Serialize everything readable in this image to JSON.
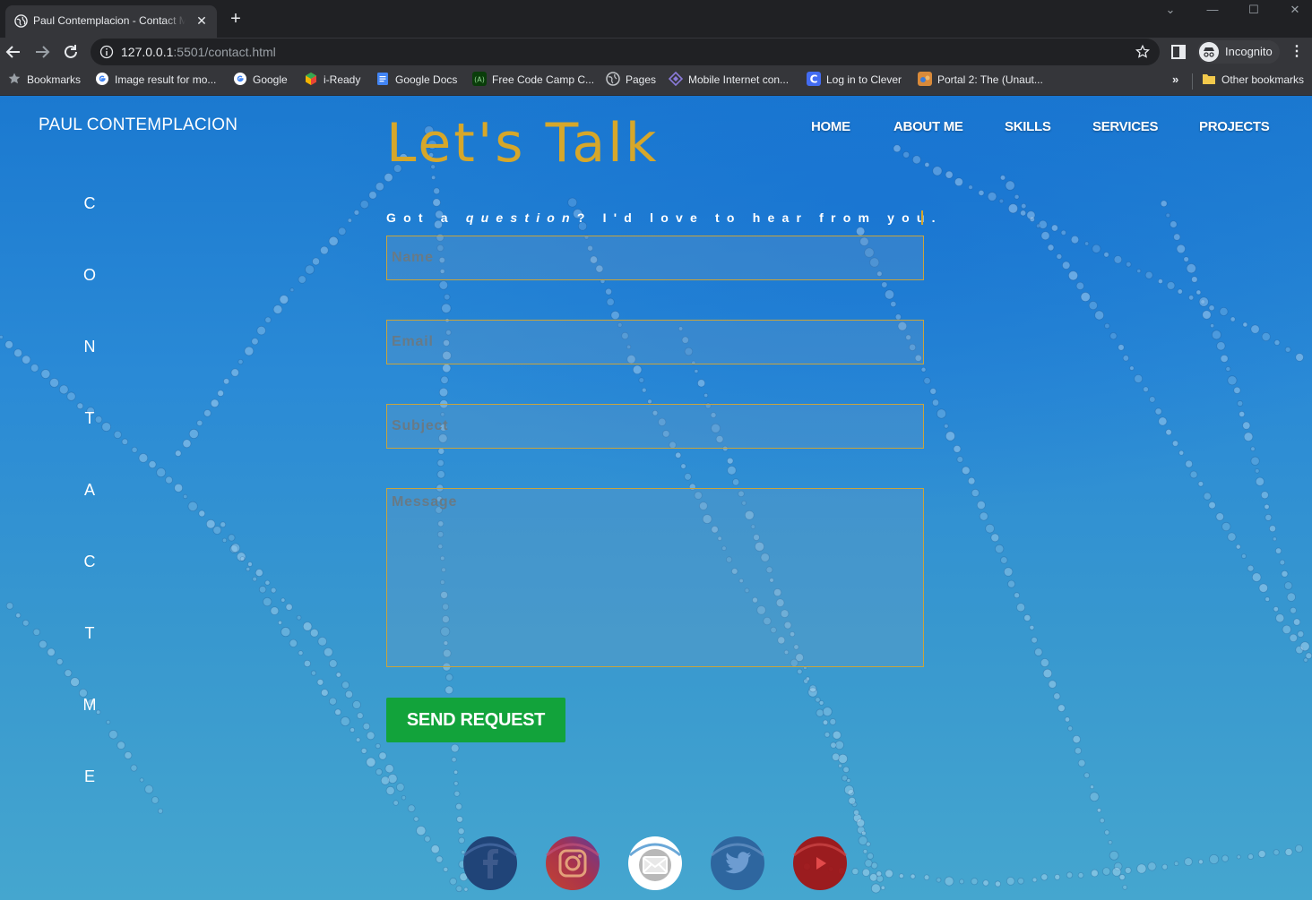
{
  "browser": {
    "tab_title": "Paul Contemplacion - Contact Me",
    "tab_close": "✕",
    "new_tab": "+",
    "window_controls": {
      "minimize": "—",
      "maximize": "☐",
      "close": "✕",
      "tabs_menu": "⌄"
    },
    "url_host": "127.0.0.1",
    "url_rest": ":5501/contact.html",
    "profile_label": "Incognito",
    "menu": "⋮",
    "bookmarks_overflow": "»",
    "bookmarks": [
      {
        "label": "Bookmarks",
        "icon": "star-icon"
      },
      {
        "label": "Image result for mo...",
        "icon": "google-icon"
      },
      {
        "label": "Google",
        "icon": "google-icon"
      },
      {
        "label": "i-Ready",
        "icon": "iready-icon"
      },
      {
        "label": "Google Docs",
        "icon": "docs-icon"
      },
      {
        "label": "Free Code Camp C...",
        "icon": "freecodecamp-icon"
      },
      {
        "label": "Pages",
        "icon": "globe-icon"
      },
      {
        "label": "Mobile Internet con...",
        "icon": "diamond-icon"
      },
      {
        "label": "Log in to Clever",
        "icon": "clever-icon"
      },
      {
        "label": "Portal 2: The (Unaut...",
        "icon": "portal-icon"
      }
    ],
    "other_bookmarks": "Other bookmarks"
  },
  "site": {
    "brand": "PAUL CONTEMPLACION",
    "vertical_letters": [
      "C",
      "O",
      "N",
      "T",
      "A",
      "C",
      "T",
      "M",
      "E"
    ],
    "headline": "Let's Talk",
    "nav": [
      "HOME",
      "ABOUT ME",
      "SKILLS",
      "SERVICES",
      "PROJECTS"
    ],
    "tagline_pre": "Got a ",
    "tagline_em": "question",
    "tagline_post": "? I'd love to hear from you.",
    "form": {
      "name_placeholder": "Name",
      "email_placeholder": "Email",
      "subject_placeholder": "Subject",
      "message_placeholder": "Message",
      "submit_label": "SEND REQUEST"
    },
    "social": [
      {
        "name": "facebook",
        "icon": "facebook-icon",
        "color": "#1d3a6e"
      },
      {
        "name": "instagram",
        "icon": "instagram-icon",
        "color": "#b3342f"
      },
      {
        "name": "email",
        "icon": "email-icon",
        "color": "#ffffff"
      },
      {
        "name": "twitter",
        "icon": "twitter-icon",
        "color": "#2c5f99"
      },
      {
        "name": "youtube",
        "icon": "youtube-icon",
        "color": "#a31010"
      }
    ]
  },
  "colors": {
    "accent_gold": "#d6a72a",
    "button_green": "#12a33b",
    "background_blue": "#2a8ad6"
  }
}
